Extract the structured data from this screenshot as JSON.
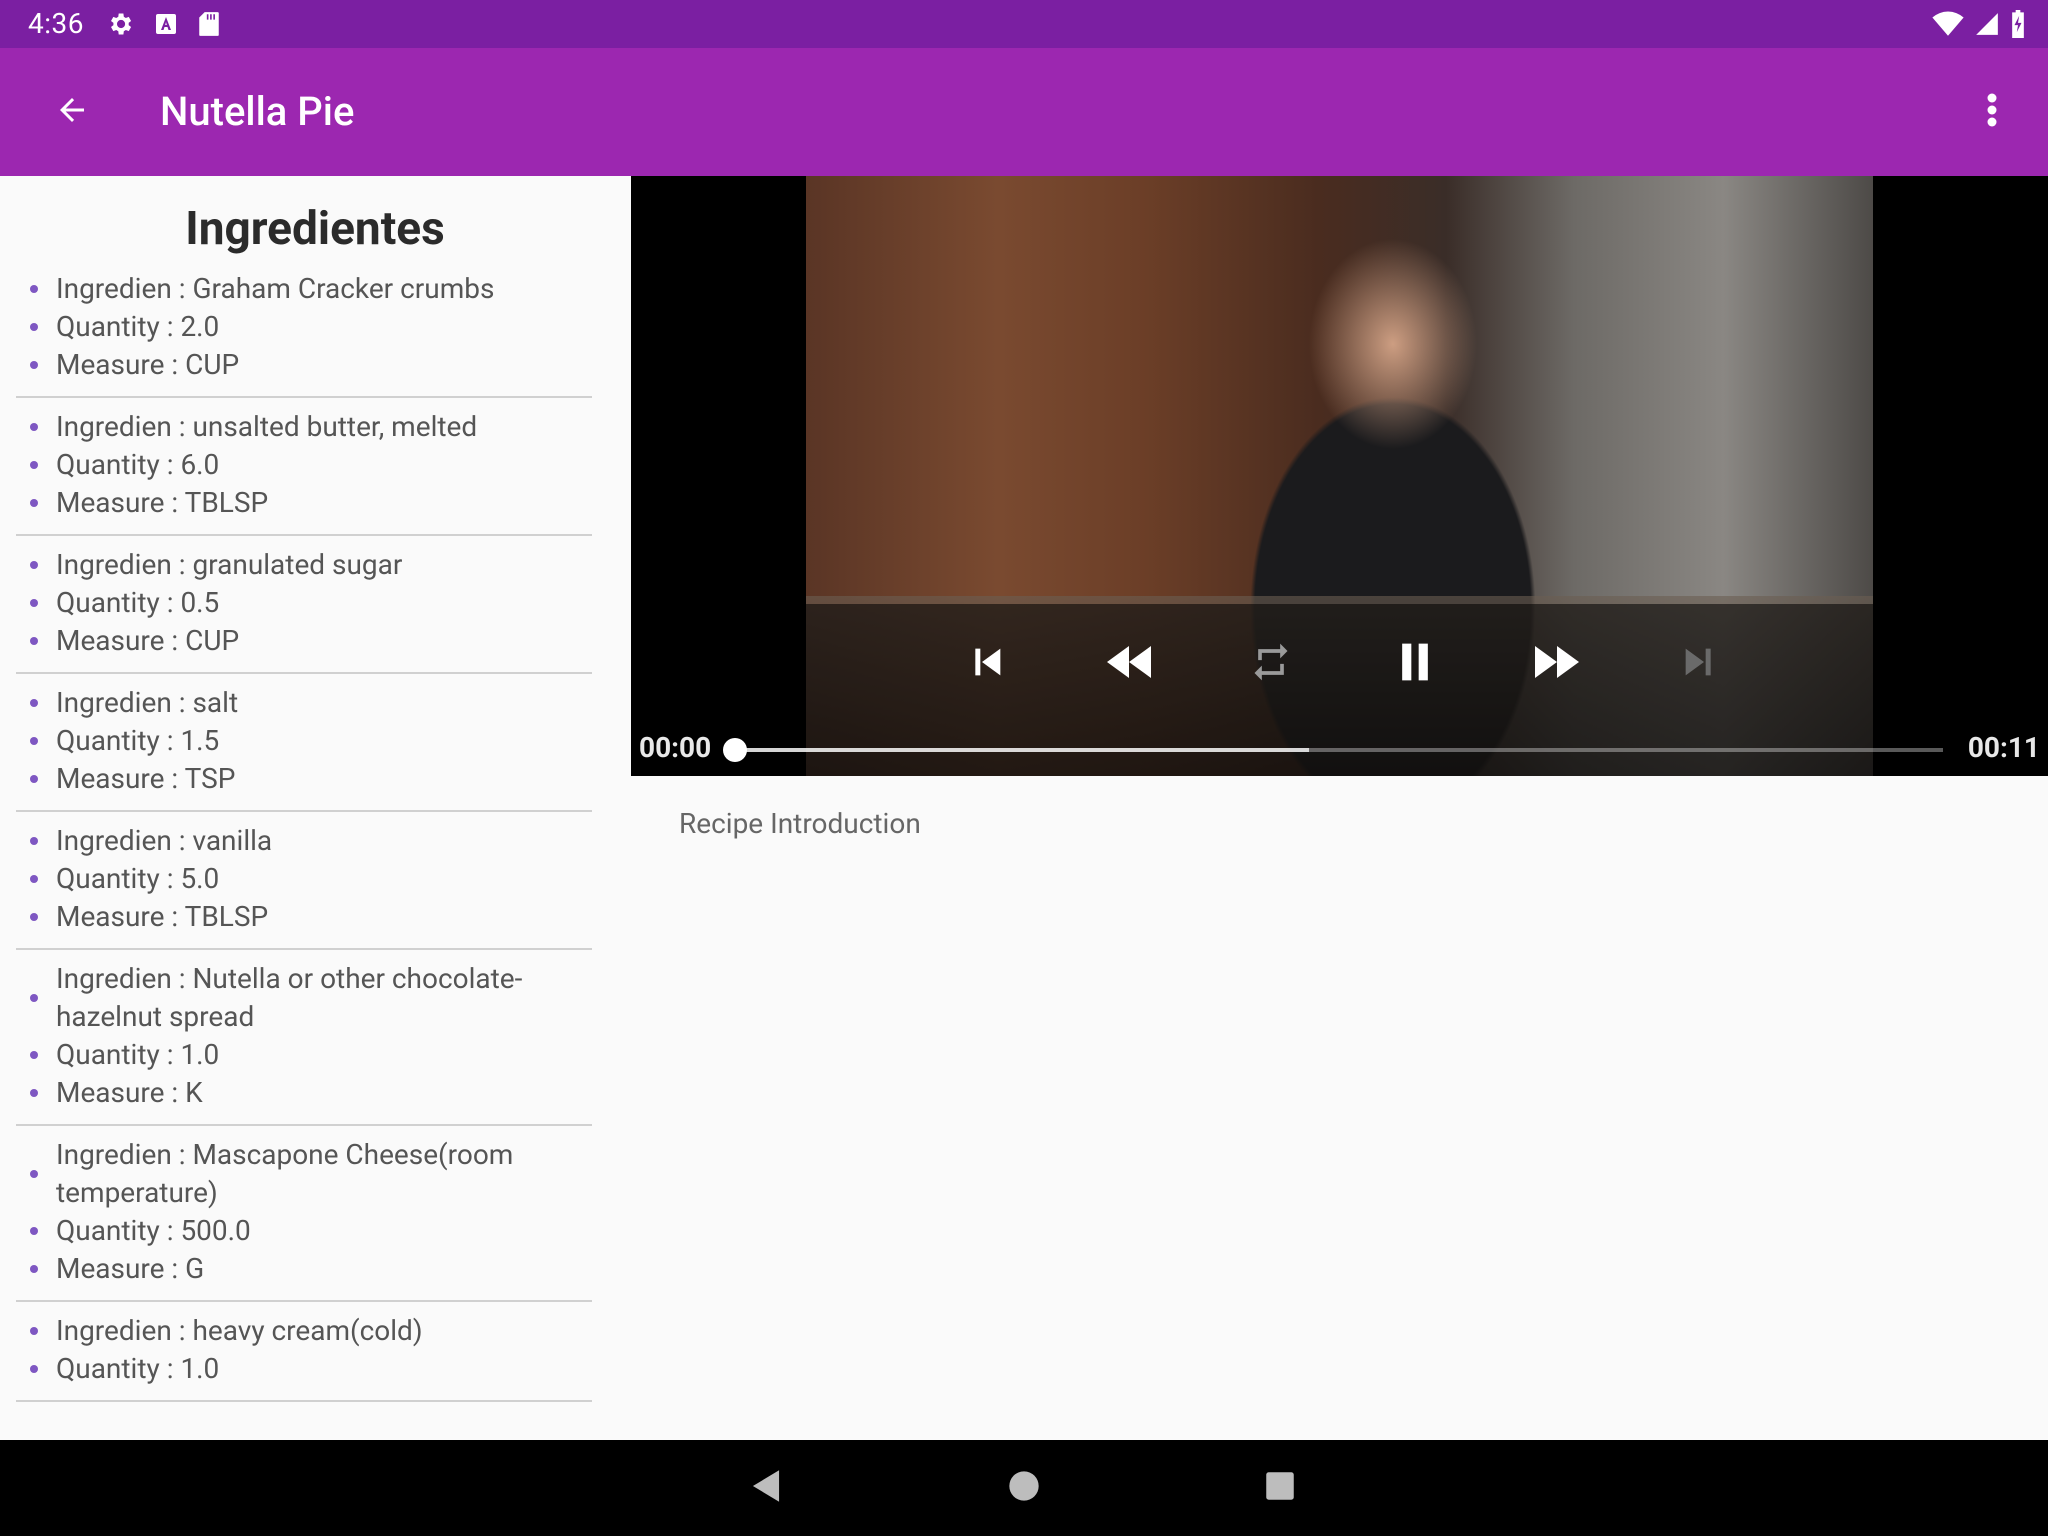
{
  "status_bar": {
    "time": "4:36"
  },
  "app_bar": {
    "title": "Nutella Pie"
  },
  "ingredients": {
    "title": "Ingredientes",
    "items": [
      {
        "ingredient": "Ingredien : Graham Cracker crumbs",
        "quantity": "Quantity : 2.0",
        "measure": "Measure : CUP"
      },
      {
        "ingredient": "Ingredien : unsalted butter, melted",
        "quantity": "Quantity : 6.0",
        "measure": "Measure : TBLSP"
      },
      {
        "ingredient": "Ingredien : granulated sugar",
        "quantity": "Quantity : 0.5",
        "measure": "Measure : CUP"
      },
      {
        "ingredient": "Ingredien : salt",
        "quantity": "Quantity : 1.5",
        "measure": "Measure : TSP"
      },
      {
        "ingredient": "Ingredien : vanilla",
        "quantity": "Quantity : 5.0",
        "measure": "Measure : TBLSP"
      },
      {
        "ingredient": "Ingredien : Nutella or other chocolate-hazelnut spread",
        "quantity": "Quantity : 1.0",
        "measure": "Measure : K"
      },
      {
        "ingredient": "Ingredien : Mascapone Cheese(room temperature)",
        "quantity": "Quantity : 500.0",
        "measure": "Measure : G"
      },
      {
        "ingredient": "Ingredien : heavy cream(cold)",
        "quantity": "Quantity : 1.0",
        "measure": ""
      }
    ]
  },
  "player": {
    "position": "00:00",
    "duration": "00:11",
    "progress": 0.0,
    "buffered": 0.475
  },
  "step": {
    "description": "Recipe Introduction"
  },
  "colors": {
    "status_bar": "#7b1fa2",
    "app_bar": "#9c27b0",
    "bullet": "#7e57c2"
  }
}
